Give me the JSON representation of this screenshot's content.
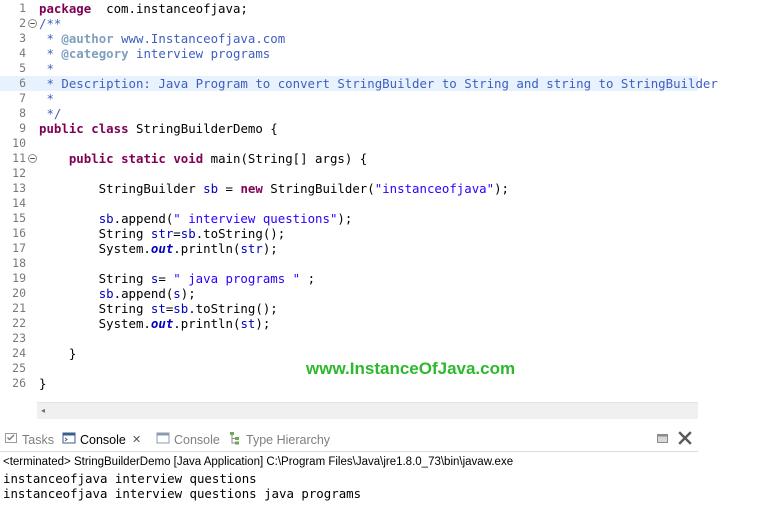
{
  "editor": {
    "lines": [
      {
        "n": "1",
        "t": [
          [
            "kw",
            "package"
          ],
          [
            "",
            "  com.instanceofjava;"
          ]
        ]
      },
      {
        "n": "2",
        "fold": "minus",
        "t": [
          [
            "cm",
            "/**"
          ]
        ]
      },
      {
        "n": "3",
        "t": [
          [
            "cm",
            " * "
          ],
          [
            "tag",
            "@author"
          ],
          [
            "cm",
            " www.Instanceofjava.com"
          ]
        ]
      },
      {
        "n": "4",
        "t": [
          [
            "cm",
            " * "
          ],
          [
            "tag",
            "@category"
          ],
          [
            "cm",
            " interview programs"
          ]
        ]
      },
      {
        "n": "5",
        "t": [
          [
            "cm",
            " *"
          ]
        ]
      },
      {
        "n": "6",
        "current": true,
        "t": [
          [
            "cm",
            " * Description: Java Program to convert StringBuilder to String and string to StringBuilder"
          ]
        ]
      },
      {
        "n": "7",
        "t": [
          [
            "cm",
            " *"
          ]
        ]
      },
      {
        "n": "8",
        "t": [
          [
            "cm",
            " */"
          ]
        ]
      },
      {
        "n": "9",
        "t": [
          [
            "kw",
            "public"
          ],
          [
            "",
            " "
          ],
          [
            "kw",
            "class"
          ],
          [
            "",
            " StringBuilderDemo {"
          ]
        ]
      },
      {
        "n": "10",
        "t": []
      },
      {
        "n": "11",
        "fold": "minus",
        "t": [
          [
            "",
            "    "
          ],
          [
            "kw",
            "public"
          ],
          [
            "",
            " "
          ],
          [
            "kw",
            "static"
          ],
          [
            "",
            " "
          ],
          [
            "kw",
            "void"
          ],
          [
            "",
            " main(String[] args) {"
          ]
        ]
      },
      {
        "n": "12",
        "t": []
      },
      {
        "n": "13",
        "t": [
          [
            "",
            "        StringBuilder "
          ],
          [
            "fld",
            "sb"
          ],
          [
            "",
            " = "
          ],
          [
            "kw",
            "new"
          ],
          [
            "",
            " StringBuilder("
          ],
          [
            "str",
            "\"instanceofjava\""
          ],
          [
            "",
            ");"
          ]
        ]
      },
      {
        "n": "14",
        "t": []
      },
      {
        "n": "15",
        "t": [
          [
            "",
            "        "
          ],
          [
            "fld",
            "sb"
          ],
          [
            "",
            ".append("
          ],
          [
            "str",
            "\" interview questions\""
          ],
          [
            "",
            ");"
          ]
        ]
      },
      {
        "n": "16",
        "t": [
          [
            "",
            "        String "
          ],
          [
            "fld",
            "str"
          ],
          [
            "",
            "="
          ],
          [
            "fld",
            "sb"
          ],
          [
            "",
            ".toString();"
          ]
        ]
      },
      {
        "n": "17",
        "t": [
          [
            "",
            "        System."
          ],
          [
            "st",
            "out"
          ],
          [
            "",
            ".println("
          ],
          [
            "fld",
            "str"
          ],
          [
            "",
            ");"
          ]
        ]
      },
      {
        "n": "18",
        "t": []
      },
      {
        "n": "19",
        "t": [
          [
            "",
            "        String "
          ],
          [
            "fld",
            "s"
          ],
          [
            "",
            "= "
          ],
          [
            "str",
            "\" java programs \""
          ],
          [
            "",
            " ;"
          ]
        ]
      },
      {
        "n": "20",
        "t": [
          [
            "",
            "        "
          ],
          [
            "fld",
            "sb"
          ],
          [
            "",
            ".append("
          ],
          [
            "fld",
            "s"
          ],
          [
            "",
            ");"
          ]
        ]
      },
      {
        "n": "21",
        "t": [
          [
            "",
            "        String "
          ],
          [
            "fld",
            "st"
          ],
          [
            "",
            "="
          ],
          [
            "fld",
            "sb"
          ],
          [
            "",
            ".toString();"
          ]
        ]
      },
      {
        "n": "22",
        "t": [
          [
            "",
            "        System."
          ],
          [
            "st",
            "out"
          ],
          [
            "",
            ".println("
          ],
          [
            "fld",
            "st"
          ],
          [
            "",
            ");"
          ]
        ]
      },
      {
        "n": "23",
        "t": []
      },
      {
        "n": "24",
        "t": [
          [
            "",
            "    }"
          ]
        ]
      },
      {
        "n": "25",
        "t": []
      },
      {
        "n": "26",
        "t": [
          [
            "",
            "}"
          ]
        ]
      }
    ]
  },
  "watermark": "www.InstanceOfJava.com",
  "scroll": {
    "left_arrow": "◂"
  },
  "console_tabs": {
    "tasks": "Tasks",
    "console_active": "Console",
    "close": "✕",
    "console2": "Console",
    "type_hierarchy": "Type Hierarchy"
  },
  "console": {
    "status": "<terminated> StringBuilderDemo [Java Application] C:\\Program Files\\Java\\jre1.8.0_73\\bin\\javaw.exe",
    "output": [
      "instanceofjava interview questions",
      "instanceofjava interview questions java programs"
    ]
  }
}
